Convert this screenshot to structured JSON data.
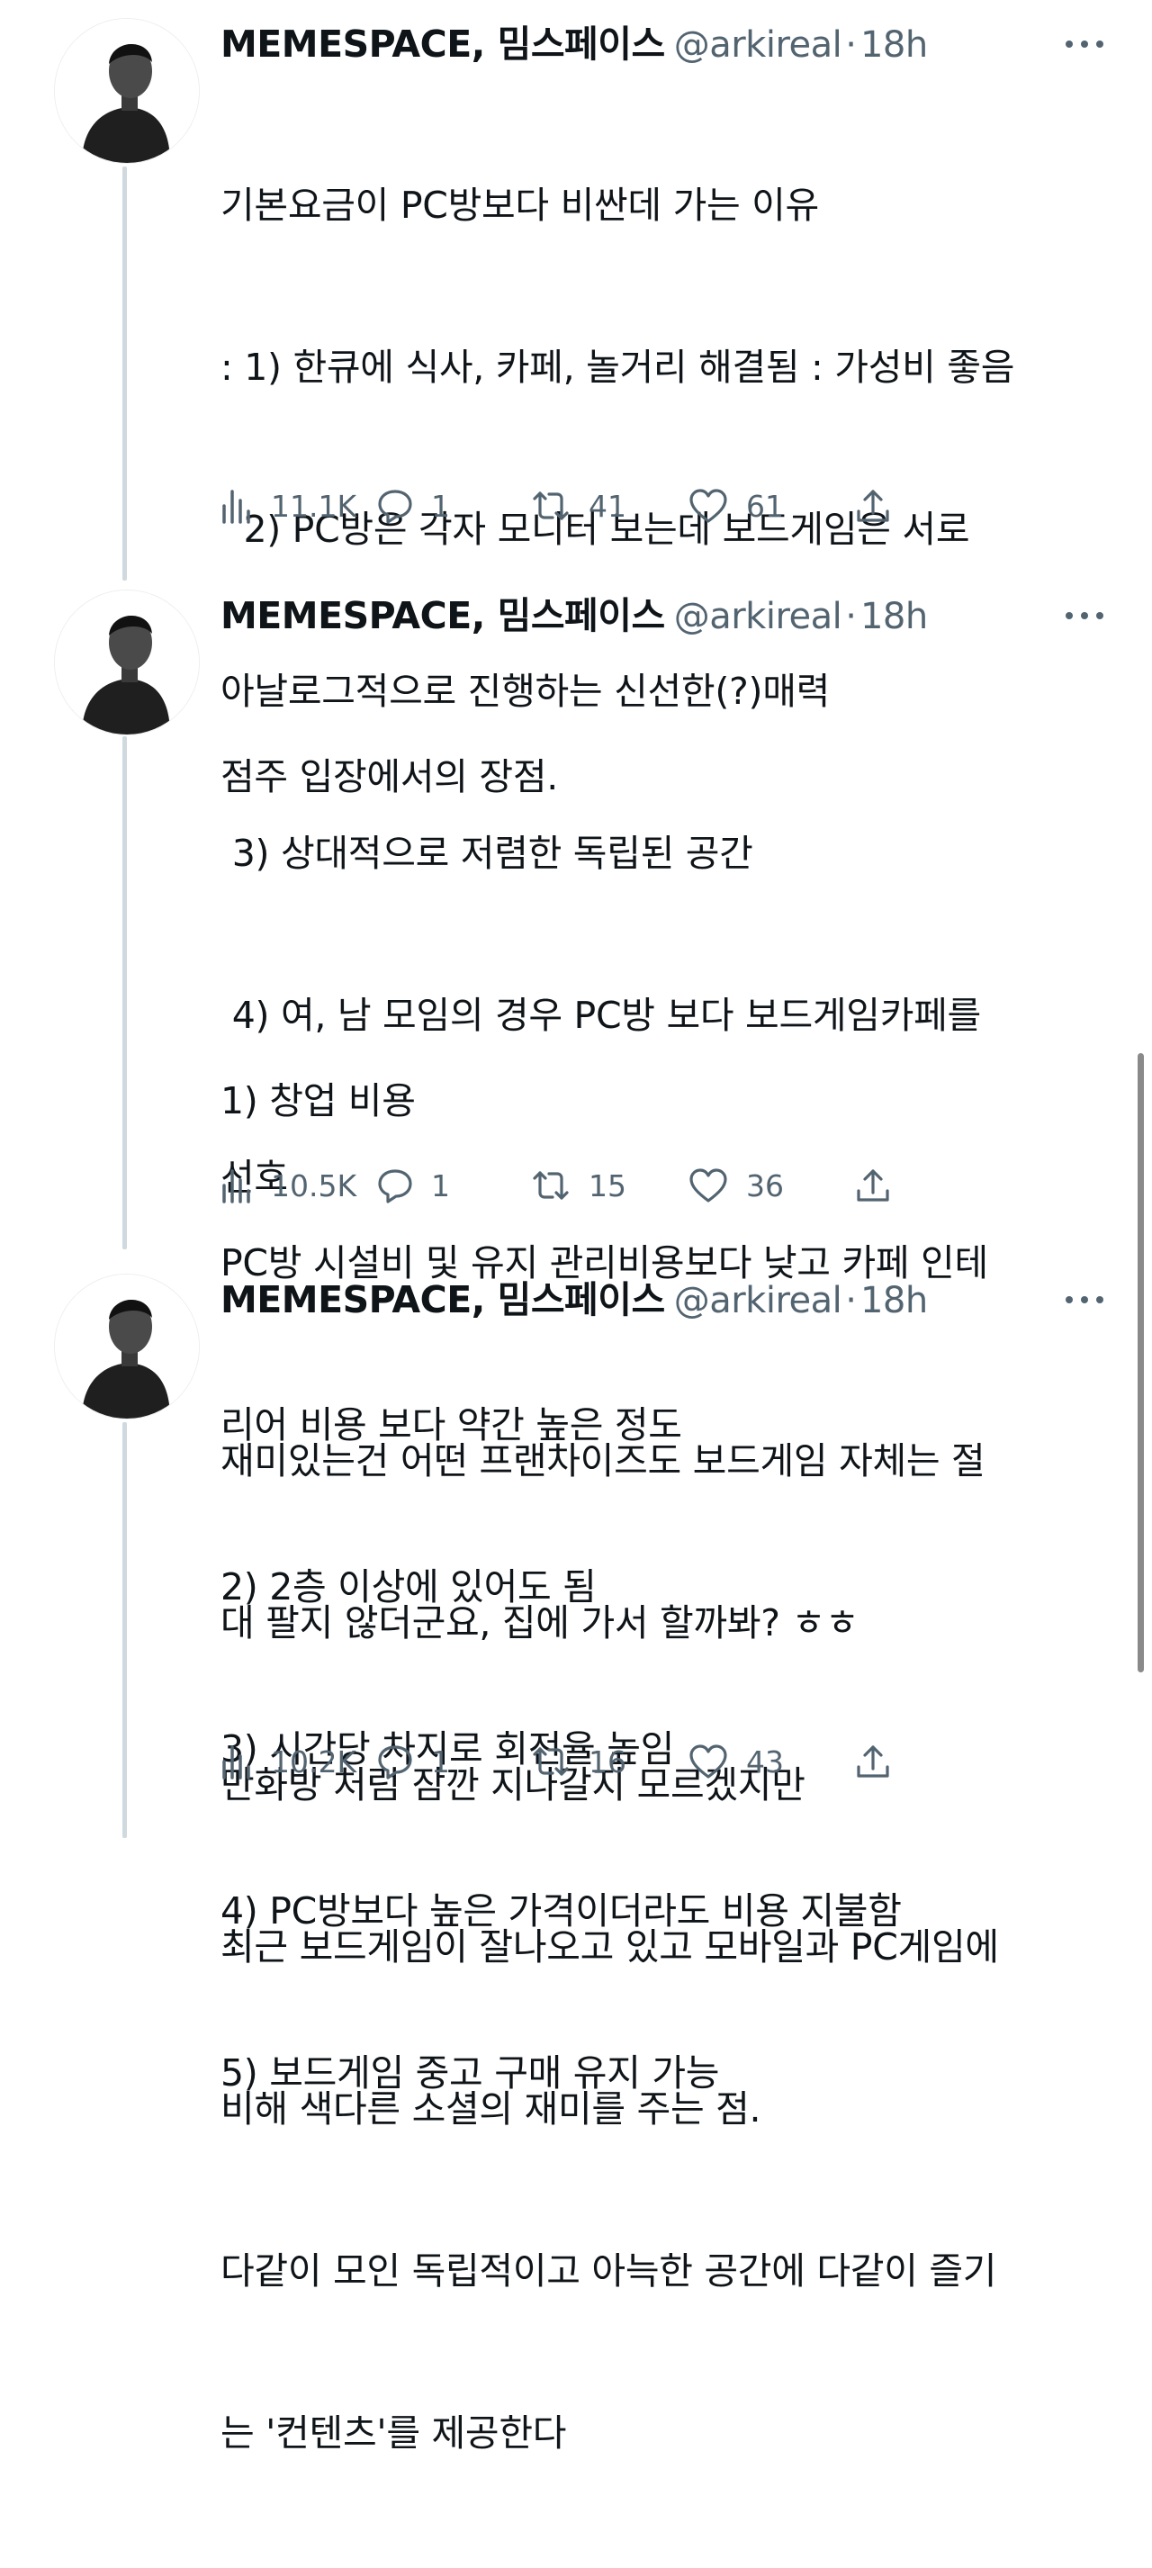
{
  "tweets": [
    {
      "display_name": "MEMESPACE, 밈스페이스",
      "handle": "@arkireal",
      "separator": "·",
      "time": "18h",
      "lines": [
        "기본요금이 PC방보다 비싼데 가는 이유",
        ": 1) 한큐에 식사, 카페, 놀거리 해결됨 : 가성비 좋음",
        "  2) PC방은 각자 모니터 보는데 보드게임은 서로",
        "아날로그적으로 진행하는 신선한(?)매력",
        " 3) 상대적으로 저렴한 독립된 공간",
        " 4) 여, 남 모임의 경우 PC방 보다 보드게임카페를",
        "선호"
      ],
      "views": "11.1K",
      "replies": "1",
      "retweets": "41",
      "likes": "61"
    },
    {
      "display_name": "MEMESPACE, 밈스페이스",
      "handle": "@arkireal",
      "separator": "·",
      "time": "18h",
      "lines": [
        "점주 입장에서의 장점.",
        "",
        "1) 창업 비용",
        "PC방 시설비 및 유지 관리비용보다 낮고 카페 인테",
        "리어 비용 보다 약간 높은 정도",
        "2) 2층 이상에 있어도 됨",
        "3) 시간당 차지로 회전율 높임",
        "4) PC방보다 높은 가격이더라도 비용 지불함",
        "5) 보드게임 중고 구매 유지 가능"
      ],
      "views": "10.5K",
      "replies": "1",
      "retweets": "15",
      "likes": "36"
    },
    {
      "display_name": "MEMESPACE, 밈스페이스",
      "handle": "@arkireal",
      "separator": "·",
      "time": "18h",
      "lines": [
        "재미있는건 어떤 프랜차이즈도 보드게임 자체는 절",
        "대 팔지 않더군요, 집에 가서 할까봐? ㅎㅎ",
        "만화방 처럼 잠깐 지나갈지 모르겠지만",
        "최근 보드게임이 잘나오고 있고 모바일과 PC게임에",
        "비해 색다른 소셜의 재미를 주는 점.",
        "다같이 모인 독립적이고 아늑한 공간에 다같이 즐기",
        "는 '컨텐츠'를 제공한다"
      ],
      "views": "10.2K",
      "replies": "1",
      "retweets": "16",
      "likes": "43"
    }
  ],
  "icons": {
    "views": "bar-chart-icon",
    "reply": "speech-bubble-icon",
    "retweet": "retweet-arrows-icon",
    "like": "heart-icon",
    "share": "share-upload-icon",
    "more": "more-dots-icon"
  },
  "colors": {
    "text": "#0f1419",
    "secondary": "#536471",
    "thread_line": "#cfd9de"
  }
}
